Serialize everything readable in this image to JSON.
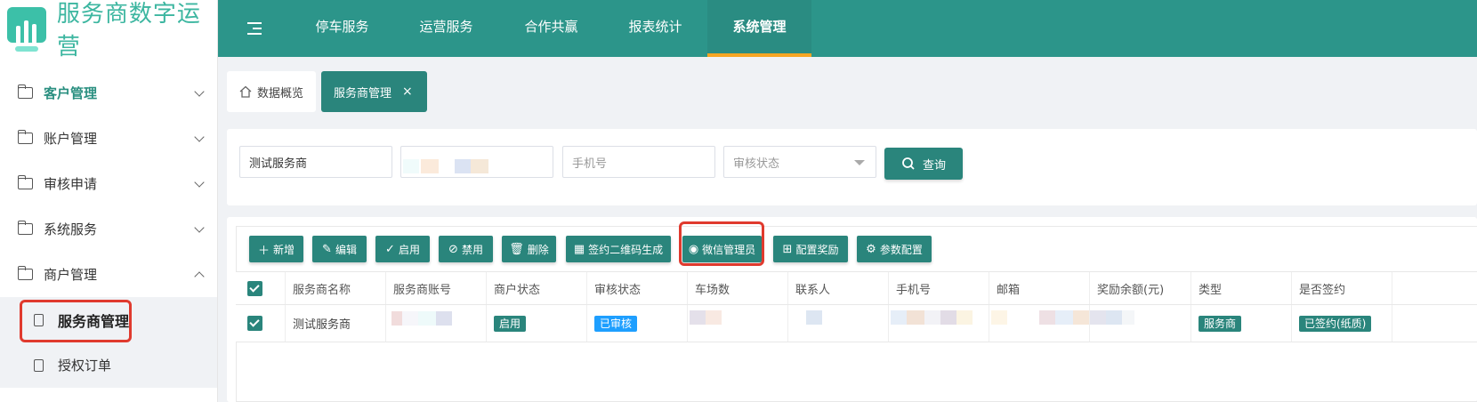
{
  "app": {
    "title": "服务商数字运营"
  },
  "sidebar": {
    "groups": [
      {
        "label": "客户管理"
      },
      {
        "label": "账户管理"
      },
      {
        "label": "审核申请"
      },
      {
        "label": "系统服务"
      },
      {
        "label": "商户管理"
      }
    ],
    "sub_items": [
      {
        "label": "服务商管理"
      },
      {
        "label": "授权订单"
      }
    ]
  },
  "topnav": {
    "items": [
      {
        "label": "停车服务"
      },
      {
        "label": "运营服务"
      },
      {
        "label": "合作共赢"
      },
      {
        "label": "报表统计"
      },
      {
        "label": "系统管理"
      }
    ]
  },
  "tabs": {
    "home": "数据概览",
    "active": "服务商管理",
    "close": "×"
  },
  "search": {
    "name_value": "测试服务商",
    "phone_placeholder": "手机号",
    "status_placeholder": "审核状态",
    "query_label": "查询"
  },
  "toolbar": {
    "add": "新增",
    "edit": "编辑",
    "enable": "启用",
    "disable": "禁用",
    "delete": "删除",
    "qr": "签约二维码生成",
    "wechat": "微信管理员",
    "reward": "配置奖励",
    "params": "参数配置"
  },
  "table": {
    "headers": [
      "服务商名称",
      "服务商账号",
      "商户状态",
      "审核状态",
      "车场数",
      "联系人",
      "手机号",
      "邮箱",
      "奖励余额(元)",
      "类型",
      "是否签约"
    ],
    "rows": [
      {
        "name": "测试服务商",
        "merchant_status": "启用",
        "audit_status": "已审核",
        "type": "服务商",
        "signed": "已签约(纸质)"
      }
    ]
  },
  "colors": {
    "primary": "#2a857c",
    "topbar": "#2c958a",
    "accent": "#f5a623",
    "highlight": "#e03a2e",
    "info": "#1e9fff"
  }
}
